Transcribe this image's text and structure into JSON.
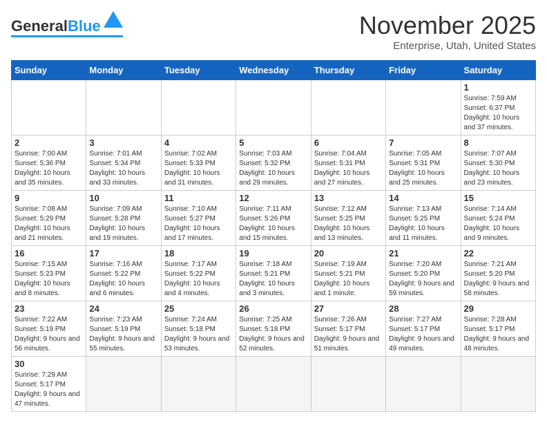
{
  "header": {
    "logo_general": "General",
    "logo_blue": "Blue",
    "month_title": "November 2025",
    "location": "Enterprise, Utah, United States"
  },
  "days_of_week": [
    "Sunday",
    "Monday",
    "Tuesday",
    "Wednesday",
    "Thursday",
    "Friday",
    "Saturday"
  ],
  "weeks": [
    [
      {
        "day": "",
        "info": ""
      },
      {
        "day": "",
        "info": ""
      },
      {
        "day": "",
        "info": ""
      },
      {
        "day": "",
        "info": ""
      },
      {
        "day": "",
        "info": ""
      },
      {
        "day": "",
        "info": ""
      },
      {
        "day": "1",
        "info": "Sunrise: 7:59 AM\nSunset: 6:37 PM\nDaylight: 10 hours and 37 minutes."
      }
    ],
    [
      {
        "day": "2",
        "info": "Sunrise: 7:00 AM\nSunset: 5:36 PM\nDaylight: 10 hours and 35 minutes."
      },
      {
        "day": "3",
        "info": "Sunrise: 7:01 AM\nSunset: 5:34 PM\nDaylight: 10 hours and 33 minutes."
      },
      {
        "day": "4",
        "info": "Sunrise: 7:02 AM\nSunset: 5:33 PM\nDaylight: 10 hours and 31 minutes."
      },
      {
        "day": "5",
        "info": "Sunrise: 7:03 AM\nSunset: 5:32 PM\nDaylight: 10 hours and 29 minutes."
      },
      {
        "day": "6",
        "info": "Sunrise: 7:04 AM\nSunset: 5:31 PM\nDaylight: 10 hours and 27 minutes."
      },
      {
        "day": "7",
        "info": "Sunrise: 7:05 AM\nSunset: 5:31 PM\nDaylight: 10 hours and 25 minutes."
      },
      {
        "day": "8",
        "info": "Sunrise: 7:07 AM\nSunset: 5:30 PM\nDaylight: 10 hours and 23 minutes."
      }
    ],
    [
      {
        "day": "9",
        "info": "Sunrise: 7:08 AM\nSunset: 5:29 PM\nDaylight: 10 hours and 21 minutes."
      },
      {
        "day": "10",
        "info": "Sunrise: 7:09 AM\nSunset: 5:28 PM\nDaylight: 10 hours and 19 minutes."
      },
      {
        "day": "11",
        "info": "Sunrise: 7:10 AM\nSunset: 5:27 PM\nDaylight: 10 hours and 17 minutes."
      },
      {
        "day": "12",
        "info": "Sunrise: 7:11 AM\nSunset: 5:26 PM\nDaylight: 10 hours and 15 minutes."
      },
      {
        "day": "13",
        "info": "Sunrise: 7:12 AM\nSunset: 5:25 PM\nDaylight: 10 hours and 13 minutes."
      },
      {
        "day": "14",
        "info": "Sunrise: 7:13 AM\nSunset: 5:25 PM\nDaylight: 10 hours and 11 minutes."
      },
      {
        "day": "15",
        "info": "Sunrise: 7:14 AM\nSunset: 5:24 PM\nDaylight: 10 hours and 9 minutes."
      }
    ],
    [
      {
        "day": "16",
        "info": "Sunrise: 7:15 AM\nSunset: 5:23 PM\nDaylight: 10 hours and 8 minutes."
      },
      {
        "day": "17",
        "info": "Sunrise: 7:16 AM\nSunset: 5:22 PM\nDaylight: 10 hours and 6 minutes."
      },
      {
        "day": "18",
        "info": "Sunrise: 7:17 AM\nSunset: 5:22 PM\nDaylight: 10 hours and 4 minutes."
      },
      {
        "day": "19",
        "info": "Sunrise: 7:18 AM\nSunset: 5:21 PM\nDaylight: 10 hours and 3 minutes."
      },
      {
        "day": "20",
        "info": "Sunrise: 7:19 AM\nSunset: 5:21 PM\nDaylight: 10 hours and 1 minute."
      },
      {
        "day": "21",
        "info": "Sunrise: 7:20 AM\nSunset: 5:20 PM\nDaylight: 9 hours and 59 minutes."
      },
      {
        "day": "22",
        "info": "Sunrise: 7:21 AM\nSunset: 5:20 PM\nDaylight: 9 hours and 58 minutes."
      }
    ],
    [
      {
        "day": "23",
        "info": "Sunrise: 7:22 AM\nSunset: 5:19 PM\nDaylight: 9 hours and 56 minutes."
      },
      {
        "day": "24",
        "info": "Sunrise: 7:23 AM\nSunset: 5:19 PM\nDaylight: 9 hours and 55 minutes."
      },
      {
        "day": "25",
        "info": "Sunrise: 7:24 AM\nSunset: 5:18 PM\nDaylight: 9 hours and 53 minutes."
      },
      {
        "day": "26",
        "info": "Sunrise: 7:25 AM\nSunset: 5:18 PM\nDaylight: 9 hours and 52 minutes."
      },
      {
        "day": "27",
        "info": "Sunrise: 7:26 AM\nSunset: 5:17 PM\nDaylight: 9 hours and 51 minutes."
      },
      {
        "day": "28",
        "info": "Sunrise: 7:27 AM\nSunset: 5:17 PM\nDaylight: 9 hours and 49 minutes."
      },
      {
        "day": "29",
        "info": "Sunrise: 7:28 AM\nSunset: 5:17 PM\nDaylight: 9 hours and 48 minutes."
      }
    ],
    [
      {
        "day": "30",
        "info": "Sunrise: 7:29 AM\nSunset: 5:17 PM\nDaylight: 9 hours and 47 minutes."
      },
      {
        "day": "",
        "info": ""
      },
      {
        "day": "",
        "info": ""
      },
      {
        "day": "",
        "info": ""
      },
      {
        "day": "",
        "info": ""
      },
      {
        "day": "",
        "info": ""
      },
      {
        "day": "",
        "info": ""
      }
    ]
  ]
}
